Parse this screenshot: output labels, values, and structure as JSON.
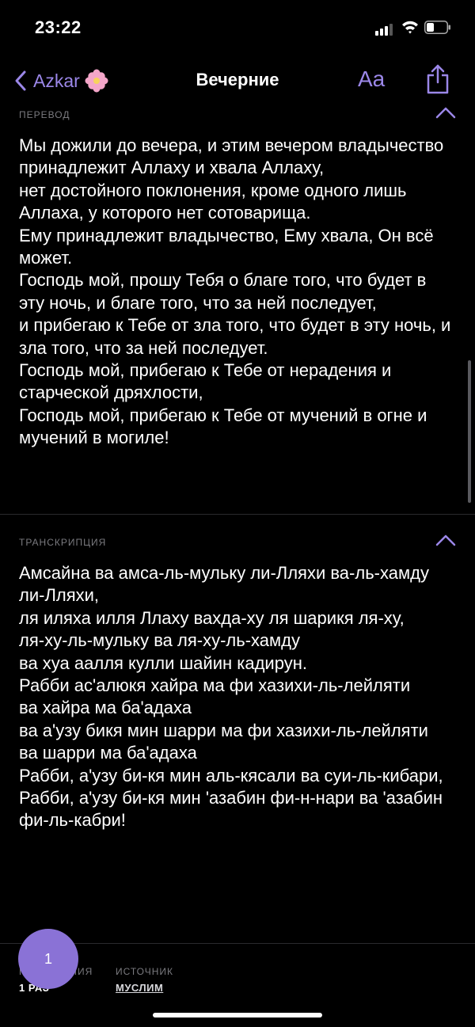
{
  "status_bar": {
    "time": "23:22",
    "icons": [
      "signal-icon",
      "wifi-icon",
      "battery-icon"
    ]
  },
  "nav": {
    "back_label": "Azkar",
    "back_emoji_icon": "flower-icon",
    "title": "Вечерние",
    "font_size_label": "Aa",
    "share_icon": "share-icon"
  },
  "colors": {
    "accent": "#9b87e8",
    "background": "#000000",
    "fab": "#8a72d6",
    "secondary_text": "#7a7a7f"
  },
  "translation": {
    "label": "ПЕРЕВОД",
    "text": "Мы дожили до вечера, и этим вечером владычество принадлежит Аллаху и хвала Аллаху,\nнет достойного поклонения, кроме одного лишь Аллаха, у которого нет сотоварища.\nЕму принадлежит владычество, Ему хвала, Он всё может.\nГосподь мой, прошу Тебя о благе того, что будет в эту ночь, и благе того, что за ней последует,\nи прибегаю к Тебе от зла того, что будет в эту ночь, и зла того, что за ней последует.\nГосподь мой, прибегаю к Тебе от нерадения и старческой дряхлости,\nГосподь мой, прибегаю к Тебе от мучений в огне и мучений в могиле!"
  },
  "transcription": {
    "label": "ТРАНСКРИПЦИЯ",
    "text": "Амсайна ва амса-ль-мульку ли-Лляхи ва-ль-хамду ли-Лляхи,\nля иляха илля Ллаху вахда-ху ля шарикя ля-ху,\nля-ху-ль-мульку ва ля-ху-ль-хамду\nва хуа аалля кулли шайин кадирун.\nРабби ас'алюкя хайра ма фи хазихи-ль-лейляти\nва хайра ма ба'адаха\nва а'узу бикя мин шарри ма фи хазихи-ль-лейляти\nва шарри ма ба'адаха\nРабби, а'узу би-кя мин аль-кясали ва суи-ль-кибари,\nРабби, а'узу би-кя мин 'азабин фи-н-нари ва 'азабин фи-ль-кабри!"
  },
  "meta": {
    "repeat_label": "ПОВТОРЕНИЯ",
    "repeat_value": "1 РАЗ",
    "source_label": "ИСТОЧНИК",
    "source_value": "МУСЛИМ"
  },
  "counter": {
    "value": "1"
  }
}
